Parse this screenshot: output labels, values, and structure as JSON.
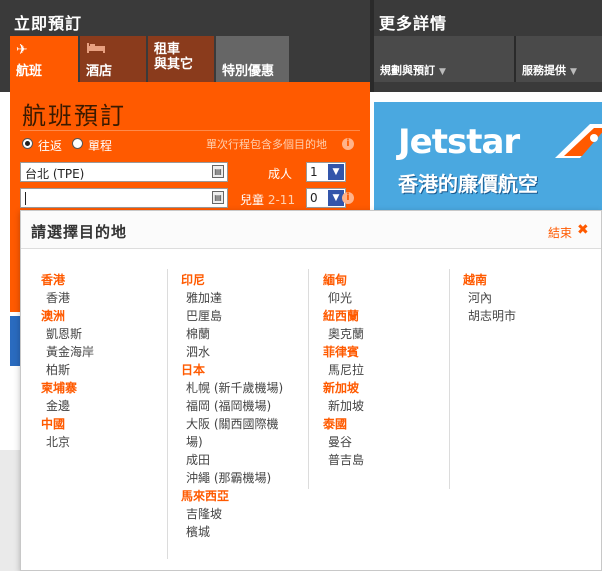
{
  "header": {
    "left_title": "立即預訂",
    "right_title": "更多詳情"
  },
  "tabs": [
    {
      "icon": "✈",
      "label": "航班"
    },
    {
      "icon": "",
      "label": "酒店"
    },
    {
      "line1": "租車",
      "line2": "與其它"
    },
    {
      "label": "特別優惠"
    }
  ],
  "menus": [
    {
      "label": "規劃與預訂"
    },
    {
      "label": "服務提供"
    }
  ],
  "booking": {
    "title": "航班預訂",
    "return_label": "往返",
    "oneway_label": "單程",
    "multi_note": "單次行程包含多個目的地",
    "origin_value": "台北 (TPE)",
    "destination_value": "",
    "adults_label": "成人",
    "adults_value": "1",
    "children_label": "兒童",
    "children_age": "2-11",
    "children_value": "0"
  },
  "ad": {
    "brand": "Jetstar",
    "tagline": "香港的廉價航空"
  },
  "popup": {
    "title": "請選擇目的地",
    "close_label": "結束",
    "columns": [
      {
        "groups": [
          {
            "region": "香港",
            "cities": [
              "香港"
            ]
          },
          {
            "region": "澳洲",
            "cities": [
              "凱恩斯",
              "黃金海岸",
              "柏斯"
            ]
          },
          {
            "region": "柬埔寨",
            "cities": [
              "金邊"
            ]
          },
          {
            "region": "中國",
            "cities": [
              "北京"
            ]
          }
        ]
      },
      {
        "groups": [
          {
            "region": "印尼",
            "cities": [
              "雅加達",
              "巴厘島",
              "棉蘭",
              "泗水"
            ]
          },
          {
            "region": "日本",
            "cities": [
              "札幌 (新千歲機場)",
              "福岡 (福岡機場)",
              "大阪 (關西國際機",
              "場)",
              "成田",
              "沖繩 (那霸機場)"
            ]
          },
          {
            "region": "馬來西亞",
            "cities": [
              "吉隆坡",
              "檳城"
            ]
          }
        ]
      },
      {
        "groups": [
          {
            "region": "緬甸",
            "cities": [
              "仰光"
            ]
          },
          {
            "region": "紐西蘭",
            "cities": [
              "奧克蘭"
            ]
          },
          {
            "region": "菲律賓",
            "cities": [
              "馬尼拉"
            ]
          },
          {
            "region": "新加坡",
            "cities": [
              "新加坡"
            ]
          },
          {
            "region": "泰國",
            "cities": [
              "曼谷",
              "普吉島"
            ]
          }
        ]
      },
      {
        "groups": [
          {
            "region": "越南",
            "cities": [
              "河內",
              "胡志明市"
            ]
          }
        ]
      }
    ]
  }
}
